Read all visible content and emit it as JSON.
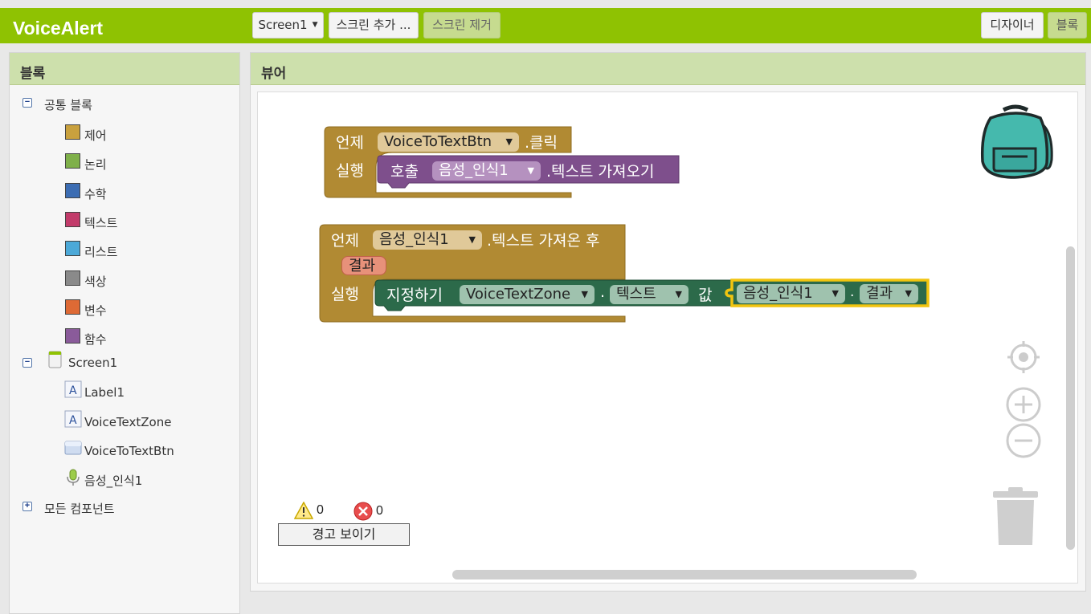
{
  "app": {
    "title": "VoiceAlert"
  },
  "toolbar": {
    "screen_select": "Screen1",
    "add_screen": "스크린 추가 ...",
    "remove_screen": "스크린 제거",
    "designer": "디자이너",
    "blocks": "블록"
  },
  "blocks_panel": {
    "title": "블록",
    "builtin_label": "공통 블록",
    "builtin": [
      {
        "label": "제어",
        "color": "#c9a13e"
      },
      {
        "label": "논리",
        "color": "#7fb04a"
      },
      {
        "label": "수학",
        "color": "#3c6db3"
      },
      {
        "label": "텍스트",
        "color": "#c23b6a"
      },
      {
        "label": "리스트",
        "color": "#4ca9d8"
      },
      {
        "label": "색상",
        "color": "#8a8a8a"
      },
      {
        "label": "변수",
        "color": "#de6a35"
      },
      {
        "label": "함수",
        "color": "#8a5b9a"
      }
    ],
    "screen_label": "Screen1",
    "components": [
      {
        "label": "Label1",
        "icon": "label-icon"
      },
      {
        "label": "VoiceTextZone",
        "icon": "label-icon"
      },
      {
        "label": "VoiceToTextBtn",
        "icon": "button-icon"
      },
      {
        "label": "음성_인식1",
        "icon": "microphone-icon"
      }
    ],
    "all_components": "모든 컴포넌트"
  },
  "viewer": {
    "title": "뷰어",
    "block1": {
      "when": "언제",
      "component": "VoiceToTextBtn",
      "event": ".클릭",
      "do": "실행",
      "call": "호출",
      "call_component": "음성_인식1",
      "method": ".텍스트 가져오기"
    },
    "block2": {
      "when": "언제",
      "component": "음성_인식1",
      "event": ".텍스트 가져온 후",
      "param": "결과",
      "do": "실행",
      "set": "지정하기",
      "set_component": "VoiceTextZone",
      "dot": ".",
      "property": "텍스트",
      "to": "값",
      "get_component": "음성_인식1",
      "get_dot": ".",
      "get_param": "결과"
    },
    "warnings_count": "0",
    "errors_count": "0",
    "show_warnings": "경고 보이기"
  },
  "colors": {
    "accent": "#8fc202",
    "panel_header": "#cde0ac",
    "control_block": "#b18a33",
    "procedure_block": "#7e4f8c",
    "component_block": "#2c6a4a",
    "selected_outline": "#f1c40f"
  }
}
